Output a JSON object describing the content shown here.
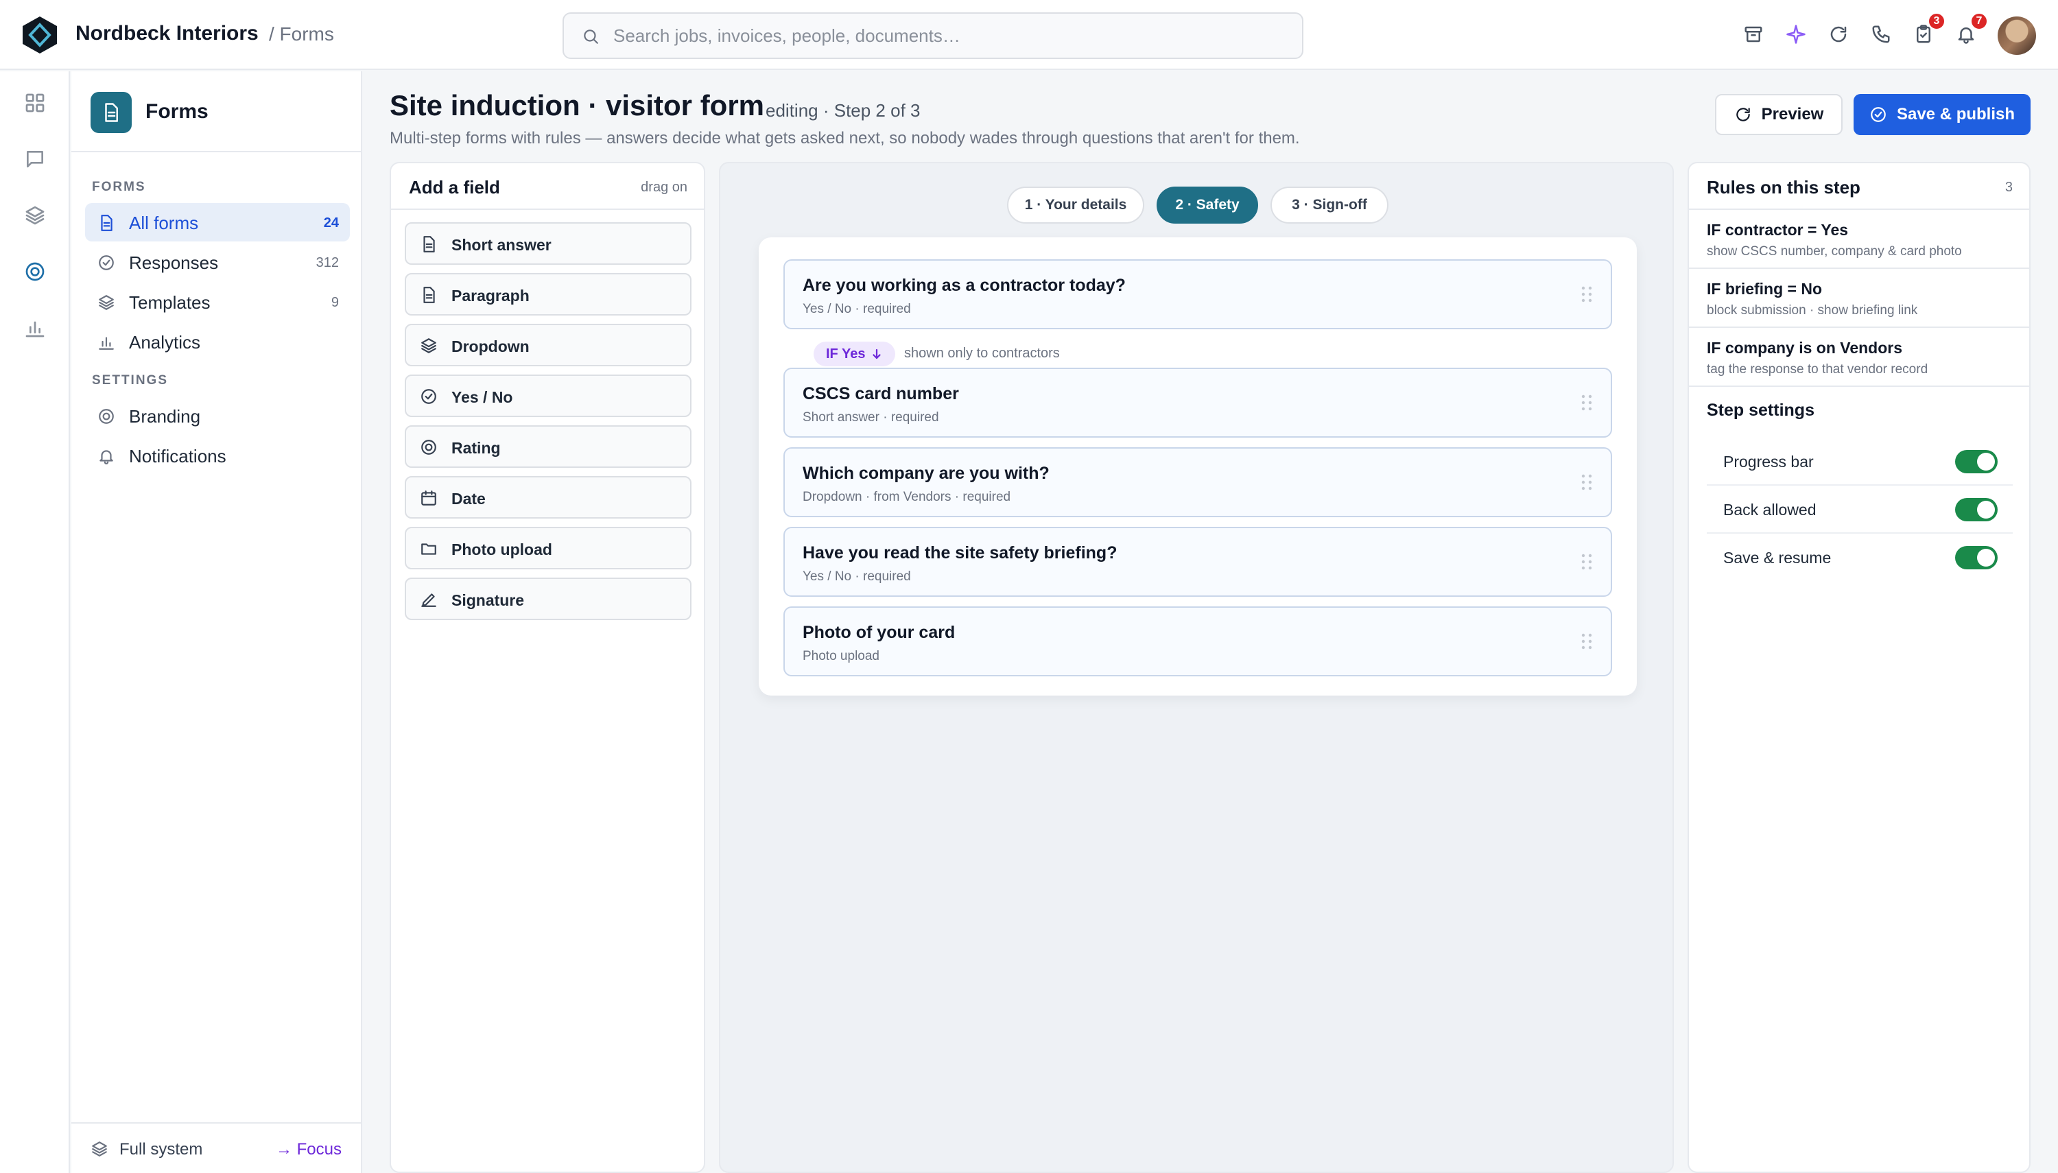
{
  "header": {
    "brand": "Nordbeck Interiors",
    "breadcrumb": "/ Forms",
    "search_placeholder": "Search jobs, invoices, people, documents…",
    "icons": [
      "archive-icon",
      "sparkle-icon",
      "refresh-icon",
      "phone-icon",
      "clipboard-icon",
      "bell-icon"
    ],
    "clipboard_badge": "3",
    "bell_badge": "7",
    "accent_color": "#8b5cf6"
  },
  "rail": {
    "items": [
      "apps-grid-icon",
      "chat-icon",
      "layers-icon",
      "forms-target-icon",
      "analytics-icon"
    ],
    "active_index": 3
  },
  "sidebar": {
    "title": "Forms",
    "forms_section": "FORMS",
    "settings_section": "SETTINGS",
    "items": [
      {
        "label": "All forms",
        "count": "24",
        "icon": "document-icon"
      },
      {
        "label": "Responses",
        "count": "312",
        "icon": "check-circle-icon"
      },
      {
        "label": "Templates",
        "count": "9",
        "icon": "layers-icon"
      },
      {
        "label": "Analytics",
        "count": "",
        "icon": "bar-chart-icon"
      }
    ],
    "settings": [
      {
        "label": "Branding",
        "icon": "target-icon"
      },
      {
        "label": "Notifications",
        "icon": "bell-icon"
      }
    ],
    "footer_label": "Full system",
    "footer_link": "→ Focus"
  },
  "page": {
    "title": "Site induction · visitor form",
    "status": "editing · Step 2 of 3",
    "subtitle": "Multi-step forms with rules — answers decide what gets asked next, so nobody wades through questions that aren't for them.",
    "preview_label": "Preview",
    "publish_label": "Save & publish",
    "primary_color": "#1f5fe0"
  },
  "palette": {
    "title": "Add a field",
    "hint": "drag on",
    "fields": [
      {
        "label": "Short answer",
        "icon": "document-icon"
      },
      {
        "label": "Paragraph",
        "icon": "document-icon"
      },
      {
        "label": "Dropdown",
        "icon": "layers-icon"
      },
      {
        "label": "Yes / No",
        "icon": "check-circle-icon"
      },
      {
        "label": "Rating",
        "icon": "target-icon"
      },
      {
        "label": "Date",
        "icon": "calendar-icon"
      },
      {
        "label": "Photo upload",
        "icon": "folder-icon"
      },
      {
        "label": "Signature",
        "icon": "pen-icon"
      }
    ]
  },
  "canvas": {
    "tabs": [
      {
        "label": "1 · Your details",
        "active": false
      },
      {
        "label": "2 · Safety",
        "active": true
      },
      {
        "label": "3 · Sign-off",
        "active": false
      }
    ],
    "questions": [
      {
        "title": "Are you working as a contractor today?",
        "meta": "Yes / No · required"
      },
      {
        "title": "CSCS card number",
        "meta": "Short answer · required"
      },
      {
        "title": "Which company are you with?",
        "meta": "Dropdown · from Vendors · required"
      },
      {
        "title": "Have you read the site safety briefing?",
        "meta": "Yes / No · required"
      },
      {
        "title": "Photo of your card",
        "meta": "Photo upload"
      }
    ],
    "condition_pill": "IF Yes",
    "condition_note": "shown only to contractors",
    "tab_color": "#1f6f86"
  },
  "rules": {
    "title": "Rules on this step",
    "count": "3",
    "items": [
      {
        "title": "IF contractor = Yes",
        "desc": "show CSCS number, company & card photo"
      },
      {
        "title": "IF briefing = No",
        "desc": "block submission · show briefing link"
      },
      {
        "title": "IF company is on Vendors",
        "desc": "tag the response to that vendor record"
      }
    ],
    "step_settings_title": "Step settings",
    "settings": [
      {
        "label": "Progress bar",
        "on": true
      },
      {
        "label": "Back allowed",
        "on": true
      },
      {
        "label": "Save & resume",
        "on": true
      }
    ],
    "toggle_color": "#1a8a4a"
  }
}
